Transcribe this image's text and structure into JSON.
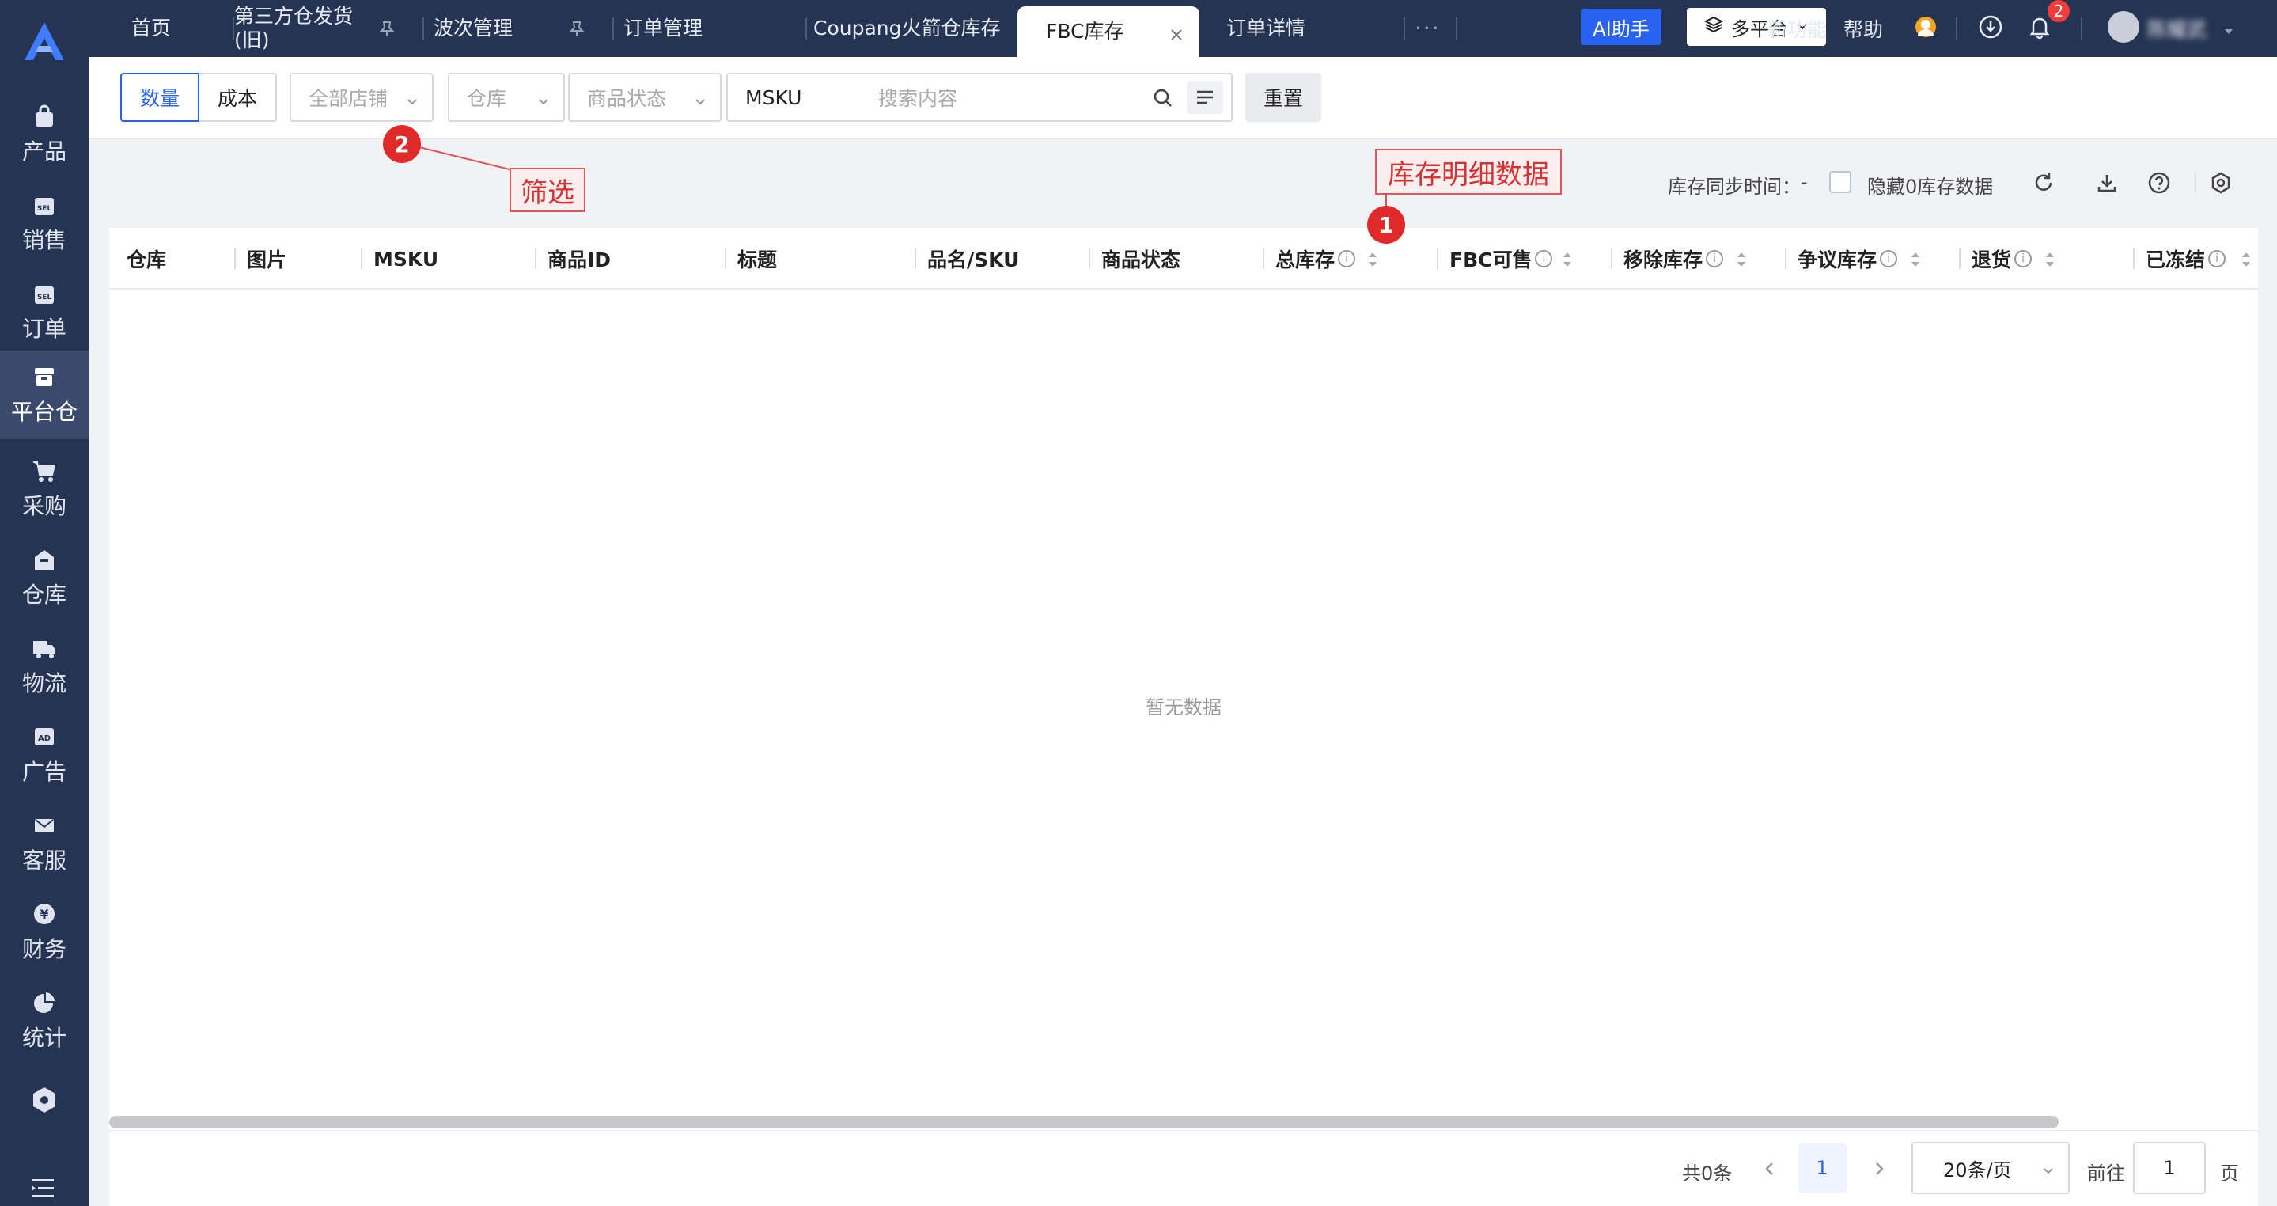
{
  "sidebar": {
    "items": [
      {
        "label": "产品",
        "icon": "bag-icon"
      },
      {
        "label": "销售",
        "icon": "sel-icon"
      },
      {
        "label": "订单",
        "icon": "sel-icon"
      },
      {
        "label": "平台仓",
        "icon": "box-icon"
      },
      {
        "label": "采购",
        "icon": "cart-icon"
      },
      {
        "label": "仓库",
        "icon": "warehouse-icon"
      },
      {
        "label": "物流",
        "icon": "truck-icon"
      },
      {
        "label": "广告",
        "icon": "ad-icon"
      },
      {
        "label": "客服",
        "icon": "mail-icon"
      },
      {
        "label": "财务",
        "icon": "yen-icon"
      },
      {
        "label": "统计",
        "icon": "pie-icon"
      }
    ],
    "active": "平台仓"
  },
  "tabs": [
    {
      "label": "首页"
    },
    {
      "label": "第三方仓发货(旧)"
    },
    {
      "label": "波次管理"
    },
    {
      "label": "订单管理"
    },
    {
      "label": "Coupang火箭仓库存"
    },
    {
      "label": "FBC库存"
    },
    {
      "label": "订单详情"
    }
  ],
  "topbar": {
    "more": "···",
    "ai_label": "AI助手",
    "platform_label": "多平台",
    "new_feature": "新功能",
    "help": "帮助",
    "notification_count": "2",
    "user_name": "陈耀武"
  },
  "filters": {
    "qty_label": "数量",
    "cost_label": "成本",
    "shop_placeholder": "全部店铺",
    "warehouse_placeholder": "仓库",
    "status_placeholder": "商品状态",
    "search_field": "MSKU",
    "search_placeholder": "搜索内容",
    "reset_label": "重置"
  },
  "toolbar": {
    "sync_label": "库存同步时间：",
    "sync_value": "-",
    "hide_zero_label": "隐藏0库存数据"
  },
  "table": {
    "columns": [
      "仓库",
      "图片",
      "MSKU",
      "商品ID",
      "标题",
      "品名/SKU",
      "商品状态",
      "总库存",
      "FBC可售",
      "移除库存",
      "争议库存",
      "退货",
      "已冻结"
    ],
    "empty_text": "暂无数据"
  },
  "pagination": {
    "total": "共0条",
    "current_page": "1",
    "page_size": "20条/页",
    "goto_label": "前往",
    "goto_value": "1",
    "page_suffix": "页"
  },
  "annotations": {
    "a1_number": "1",
    "a1_text": "库存明细数据",
    "a2_number": "2",
    "a2_text": "筛选"
  },
  "colors": {
    "sidebar_bg": "#263453",
    "primary": "#2a62f0",
    "annotation": "#e02a2a"
  }
}
